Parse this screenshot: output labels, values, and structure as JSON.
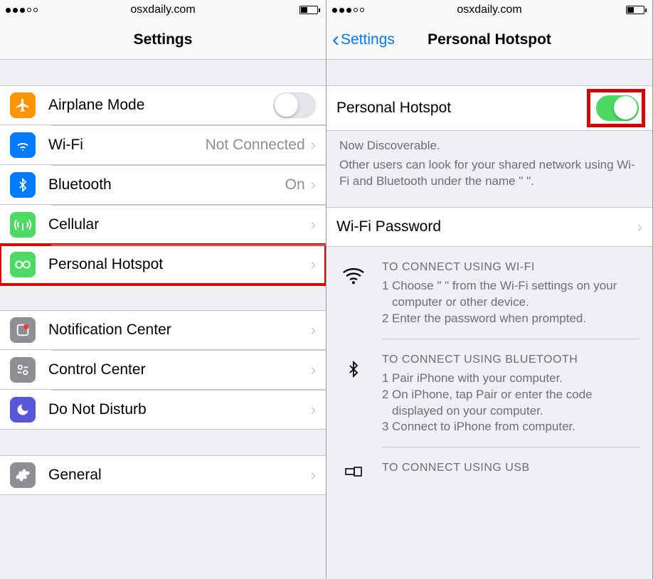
{
  "left": {
    "status": {
      "url": "osxdaily.com"
    },
    "nav": {
      "title": "Settings"
    },
    "rows": {
      "airplane": {
        "label": "Airplane Mode"
      },
      "wifi": {
        "label": "Wi-Fi",
        "value": "Not Connected"
      },
      "bluetooth": {
        "label": "Bluetooth",
        "value": "On"
      },
      "cellular": {
        "label": "Cellular"
      },
      "hotspot": {
        "label": "Personal Hotspot"
      },
      "notif": {
        "label": "Notification Center"
      },
      "control": {
        "label": "Control Center"
      },
      "dnd": {
        "label": "Do Not Disturb"
      },
      "general": {
        "label": "General"
      }
    }
  },
  "right": {
    "status": {
      "url": "osxdaily.com"
    },
    "nav": {
      "back": "Settings",
      "title": "Personal Hotspot"
    },
    "toggle_row": {
      "label": "Personal Hotspot"
    },
    "discoverable": {
      "line1": "Now Discoverable.",
      "line2": "Other users can look for your shared network using Wi-Fi and Bluetooth under the name \"                          \"."
    },
    "wifi_pw": {
      "label": "Wi-Fi Password"
    },
    "instr_wifi": {
      "title": "TO CONNECT USING WI-FI",
      "step1": "Choose \"                          \" from the Wi-Fi settings on your computer or other device.",
      "step2": "Enter the password when prompted."
    },
    "instr_bt": {
      "title": "TO CONNECT USING BLUETOOTH",
      "step1": "Pair iPhone with your computer.",
      "step2": "On iPhone, tap Pair or enter the code displayed on your computer.",
      "step3": "Connect to iPhone from computer."
    },
    "instr_usb": {
      "title": "TO CONNECT USING USB"
    }
  }
}
